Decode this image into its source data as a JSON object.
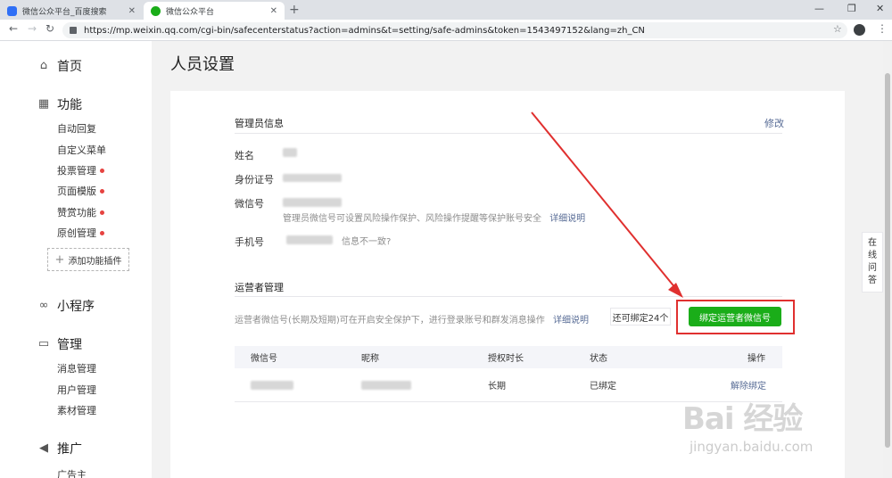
{
  "browser": {
    "tabs": [
      {
        "label": "微信公众平台_百度搜索",
        "close": "✕"
      },
      {
        "label": "微信公众平台",
        "close": "✕"
      }
    ],
    "new_tab": "+",
    "window_controls": {
      "minimize": "—",
      "restore": "❐",
      "close": "✕"
    },
    "url": "https://mp.weixin.qq.com/cgi-bin/safecenterstatus?action=admins&t=setting/safe-admins&token=1543497152&lang=zh_CN"
  },
  "sidebar": {
    "home": "首页",
    "features": {
      "title": "功能",
      "items": [
        {
          "label": "自动回复",
          "dot": false
        },
        {
          "label": "自定义菜单",
          "dot": false
        },
        {
          "label": "投票管理",
          "dot": true
        },
        {
          "label": "页面模版",
          "dot": true
        },
        {
          "label": "赞赏功能",
          "dot": true
        },
        {
          "label": "原创管理",
          "dot": true
        }
      ],
      "add_plugin": "添加功能插件"
    },
    "miniprogram": "小程序",
    "manage": {
      "title": "管理",
      "items": [
        "消息管理",
        "用户管理",
        "素材管理"
      ]
    },
    "promote": {
      "title": "推广",
      "items": [
        "广告主"
      ]
    }
  },
  "page_title": "人员设置",
  "admin_info": {
    "title": "管理员信息",
    "edit": "修改",
    "name_label": "姓名",
    "id_label": "身份证号",
    "wechat_label": "微信号",
    "wechat_desc": "管理员微信号可设置风险操作保护、风险操作提醒等保护账号安全",
    "wechat_detail": "详细说明",
    "phone_label": "手机号",
    "phone_mismatch": "信息不一致?"
  },
  "operator": {
    "title": "运营者管理",
    "desc": "运营者微信号(长期及短期)可在开启安全保护下，进行登录账号和群发消息操作",
    "detail": "详细说明",
    "remaining": "还可绑定24个",
    "bind_button": "绑定运营者微信号",
    "columns": [
      "微信号",
      "昵称",
      "授权时长",
      "状态",
      "操作"
    ],
    "rows": [
      {
        "duration": "长期",
        "status": "已绑定",
        "action": "解除绑定"
      }
    ]
  },
  "float_qa": [
    "在",
    "线",
    "问",
    "答"
  ],
  "watermark": {
    "main": "Bai 经验",
    "sub": "jingyan.baidu.com"
  },
  "colors": {
    "accent_green": "#1aad19",
    "link_blue": "#576b95",
    "annotation_red": "#e0302f",
    "dot_red": "#e64340"
  }
}
